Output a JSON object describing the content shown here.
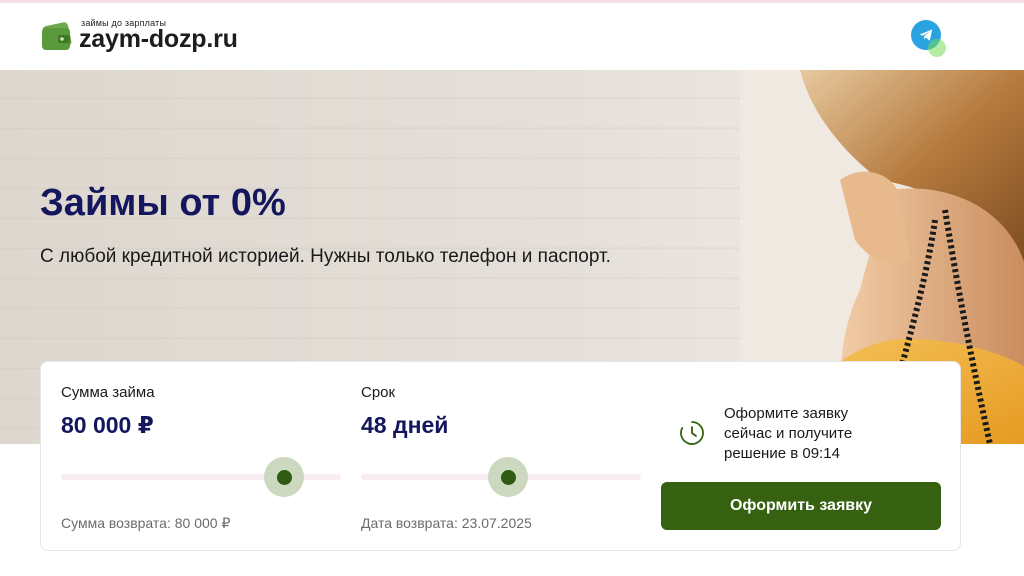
{
  "header": {
    "logo_small": "займы до зарплаты",
    "logo_main": "zaym-dozp.ru",
    "telegram_icon": "telegram-icon"
  },
  "hero": {
    "title": "Займы от 0%",
    "subtitle": "С любой кредитной историей. Нужны только телефон и паспорт."
  },
  "calculator": {
    "amount": {
      "label": "Сумма займа",
      "value": "80 000 ₽",
      "slider_fraction": 0.8,
      "return_text": "Сумма возврата: 80 000 ₽"
    },
    "term": {
      "label": "Срок",
      "value": "48 дней",
      "slider_fraction": 0.53,
      "return_text": "Дата возврата: 23.07.2025"
    },
    "info_text": "Оформите заявку сейчас и получите решение в 09:14",
    "apply_button": "Оформить заявку"
  },
  "colors": {
    "accent": "#356111",
    "title": "#14175e",
    "telegram": "#2aa3e0"
  }
}
